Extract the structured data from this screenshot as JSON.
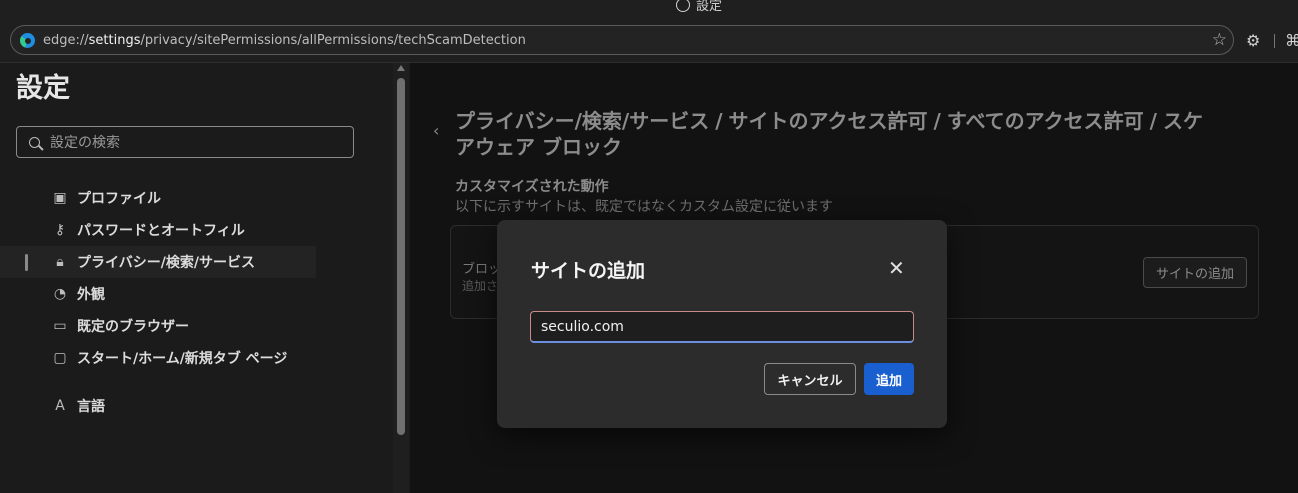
{
  "window": {
    "title": "設定"
  },
  "address_bar": {
    "url_prefix": "edge://",
    "url_host": "settings",
    "url_path": "/privacy/sitePermissions/allPermissions/techScamDetection"
  },
  "sidebar": {
    "title": "設定",
    "search_placeholder": "設定の検索",
    "items": [
      {
        "label": "プロファイル",
        "icon": "profile-icon"
      },
      {
        "label": "パスワードとオートフィル",
        "icon": "key-icon"
      },
      {
        "label": "プライバシー/検索/サービス",
        "icon": "lock-icon",
        "active": true
      },
      {
        "label": "外観",
        "icon": "palette-icon"
      },
      {
        "label": "既定のブラウザー",
        "icon": "browser-icon"
      },
      {
        "label": "スタート/ホーム/新規タブ ページ",
        "icon": "home-page-icon"
      },
      {
        "label": "言語",
        "icon": "language-icon"
      }
    ]
  },
  "main": {
    "breadcrumb": [
      "プライバシー/検索/サービス",
      "サイトのアクセス許可",
      "すべてのアクセス許可",
      "スケアウェア ブロック"
    ],
    "breadcrumb_separator": "/",
    "section_title": "カスタマイズされた動作",
    "section_description": "以下に示すサイトは、既定ではなくカスタム設定に従います",
    "card": {
      "label_partial": "ブロッ",
      "sub_partial": "追加さ",
      "add_button": "サイトの追加"
    }
  },
  "dialog": {
    "title": "サイトの追加",
    "input_value": "seculio.com",
    "cancel_label": "キャンセル",
    "add_label": "追加",
    "accent_color": "#1a5fcf"
  }
}
